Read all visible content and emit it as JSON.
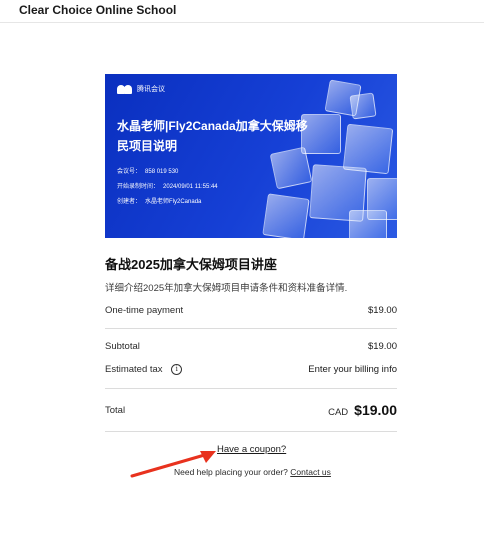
{
  "header": {
    "brand": "Clear Choice Online School"
  },
  "banner": {
    "logo_text": "腾讯会议",
    "title": "水晶老师|Fly2Canada加拿大保姆移民项目说明",
    "meeting_id_label": "会议号：",
    "meeting_id": "858 019 530",
    "recording_label": "开始录制时间：",
    "recording_time": "2024/09/01 11:55:44",
    "creator_label": "创建者：",
    "creator": "水晶老师Fly2Canada"
  },
  "course": {
    "title": "备战2025加拿大保姆项目讲座",
    "description": "详细介绍2025年加拿大保姆项目申请条件和资料准备详情."
  },
  "pricing": {
    "payment_label": "One-time payment",
    "payment_value": "$19.00",
    "subtotal_label": "Subtotal",
    "subtotal_value": "$19.00",
    "tax_label": "Estimated tax",
    "tax_value": "Enter your billing info",
    "total_label": "Total",
    "total_currency": "CAD",
    "total_value": "$19.00"
  },
  "coupon_link": "Have a coupon?",
  "help": {
    "text": "Need help placing your order?",
    "link": "Contact us"
  },
  "colors": {
    "banner_blue": "#1640d6",
    "arrow_red": "#e8321e"
  }
}
